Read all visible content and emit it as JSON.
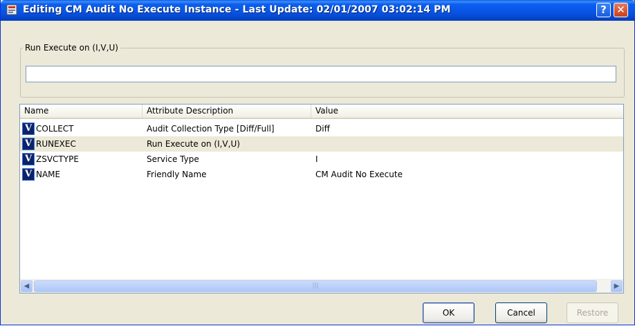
{
  "window": {
    "title": "Editing CM Audit No Execute Instance - Last Update: 02/01/2007 03:02:14 PM",
    "help_label": "?",
    "close_label": "✕"
  },
  "group": {
    "label": "Run Execute on (I,V,U)",
    "input_value": ""
  },
  "table": {
    "columns": [
      "Name",
      "Attribute Description",
      "Value"
    ],
    "rows": [
      {
        "icon": "V",
        "name": "COLLECT",
        "description": "Audit Collection Type [Diff/Full]",
        "value": "Diff"
      },
      {
        "icon": "V",
        "name": "RUNEXEC",
        "description": "Run Execute on (I,V,U)",
        "value": ""
      },
      {
        "icon": "V",
        "name": "ZSVCTYPE",
        "description": "Service Type",
        "value": "I"
      },
      {
        "icon": "V",
        "name": "NAME",
        "description": "Friendly Name",
        "value": "CM Audit No Execute"
      }
    ],
    "scroll_grip": "|||"
  },
  "buttons": {
    "ok": "OK",
    "cancel": "Cancel",
    "restore": "Restore"
  },
  "colors": {
    "titlebar": "#0854e3",
    "window_bg": "#ece9d8",
    "selected_row": "#ece9d8"
  }
}
